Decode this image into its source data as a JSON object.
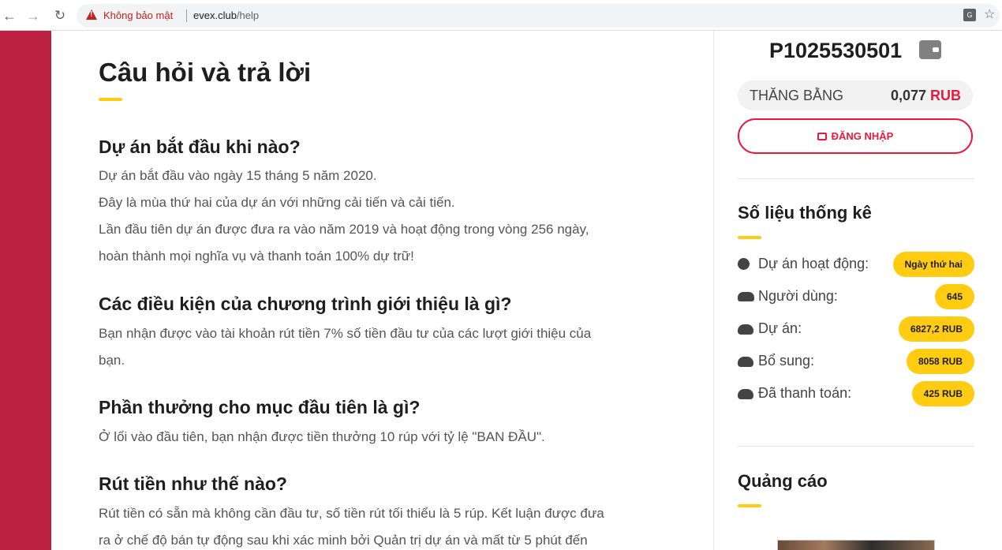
{
  "browser": {
    "security_label": "Không bảo mật",
    "url_host": "evex.club",
    "url_path": "/help"
  },
  "main": {
    "title": "Câu hỏi và trả lời",
    "faq": [
      {
        "question": "Dự án bắt đầu khi nào?",
        "answer_lines": [
          "Dự án bắt đầu vào ngày 15 tháng 5 năm 2020.",
          "Đây là mùa thứ hai của dự án với những cải tiến và cải tiến.",
          "Lần đầu tiên dự án được đưa ra vào năm 2019 và hoạt động trong vòng 256 ngày,",
          "hoàn thành mọi nghĩa vụ và thanh toán 100% dự trữ!"
        ]
      },
      {
        "question": "Các điều kiện của chương trình giới thiệu là gì?",
        "answer_lines": [
          "Bạn nhận được vào tài khoản rút tiền 7% số tiền đầu tư của các lượt giới thiệu của",
          "bạn."
        ]
      },
      {
        "question": "Phần thưởng cho mục đầu tiên là gì?",
        "answer_lines": [
          "Ở lối vào đầu tiên, bạn nhận được tiền thưởng 10 rúp với tỷ lệ \"BAN ĐẦU\"."
        ]
      },
      {
        "question": "Rút tiền như thế nào?",
        "answer_lines": [
          "Rút tiền có sẵn mà không cần đầu tư, số tiền rút tối thiểu là 5 rúp. Kết luận được đưa",
          "ra ở chế độ bán tự động sau khi xác minh bởi Quản trị dự án và mất từ 5 phút đến"
        ]
      }
    ]
  },
  "sidebar": {
    "account_id": "P1025530501",
    "balance_label": "THĂNG BẰNG",
    "balance_value": "0,077",
    "balance_currency": "RUB",
    "login_label": "ĐĂNG NHẬP",
    "stats_heading": "Số liệu thống kê",
    "stats": [
      {
        "icon": "clock-icon",
        "label": "Dự án hoạt động:",
        "value": "Ngày thứ hai"
      },
      {
        "icon": "users-icon",
        "label": "Người dùng:",
        "value": "645"
      },
      {
        "icon": "cloud-icon",
        "label": "Dự án:",
        "value": "6827,2 RUB"
      },
      {
        "icon": "cloud-upload-icon",
        "label": "Bổ sung:",
        "value": "8058 RUB"
      },
      {
        "icon": "cloud-download-icon",
        "label": "Đã thanh toán:",
        "value": "425 RUB"
      }
    ],
    "ads_heading": "Quảng cáo"
  },
  "colors": {
    "brand_red": "#bb2040",
    "accent_red": "#e8193c",
    "accent_yellow": "#ffcc11"
  }
}
